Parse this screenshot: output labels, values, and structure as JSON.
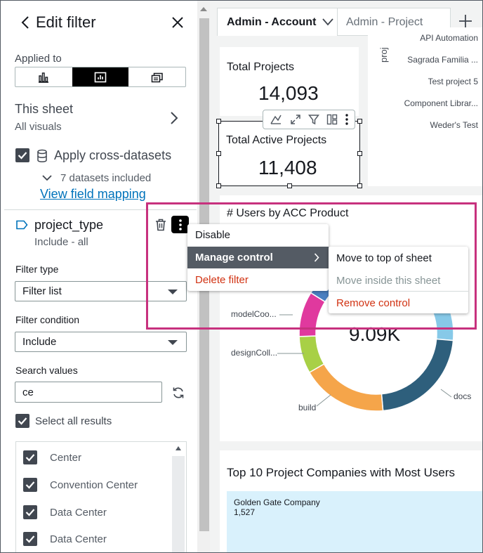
{
  "panel": {
    "title": "Edit filter",
    "applied_to_label": "Applied to",
    "applied_to_options": [
      "bar-chart-icon",
      "visual-icon",
      "multi-sheet-icon"
    ],
    "applied_to_selected": 1,
    "sheet_title": "This sheet",
    "sheet_subtitle": "All visuals",
    "cross_datasets_label": "Apply cross-datasets",
    "cross_datasets_checked": true,
    "datasets_included": "7 datasets included",
    "field_mapping_link": "View field mapping",
    "filter_name": "project_type",
    "filter_summary": "Include - all",
    "filter_type_label": "Filter type",
    "filter_type_value": "Filter list",
    "filter_condition_label": "Filter condition",
    "filter_condition_value": "Include",
    "search_values_label": "Search values",
    "search_value": "ce",
    "select_all_label": "Select all results",
    "select_all_checked": true,
    "results": [
      {
        "label": "Center",
        "checked": true
      },
      {
        "label": "Convention Center",
        "checked": true
      },
      {
        "label": "Data Center",
        "checked": true
      },
      {
        "label": "Data Center",
        "checked": true
      }
    ]
  },
  "tabs": {
    "active": "Admin - Account",
    "inactive": "Admin - Project"
  },
  "dashboard": {
    "total_projects_title": "Total Projects",
    "total_projects_value": "14,093",
    "active_projects_title": "Total Active Projects",
    "active_projects_value": "11,408",
    "bar_chart_axis_title": "proj",
    "bar_chart_labels": [
      "API Automation",
      "Sagrada Familia ...",
      "Test project 5",
      "Component Librar...",
      "Weder's Test"
    ],
    "donut_title": "# Users by ACC Product",
    "donut_center": "9.09K",
    "donut_labels": {
      "model": "modelCoo...",
      "design": "designColl...",
      "build": "build",
      "docs": "docs"
    },
    "top10_title": "Top 10 Project Companies with Most Users",
    "top10_first_name": "Golden Gate Company",
    "top10_first_value": "1,527"
  },
  "context_menu": {
    "items": [
      "Disable",
      "Manage control",
      "Delete filter"
    ],
    "active_index": 1
  },
  "submenu": {
    "items": [
      "Move to top of sheet",
      "Move inside this sheet",
      "Remove control"
    ],
    "disabled_index": 1
  },
  "chart_data": {
    "type": "pie",
    "title": "# Users by ACC Product",
    "center_label": "9.09K",
    "categories": [
      "docs",
      "build",
      "designColl...",
      "modelCoo..."
    ],
    "values": [
      30,
      19,
      8,
      9
    ],
    "colors": {
      "docs": "#2e5f7c",
      "build": "#f5a54a",
      "design": "#a8d046",
      "model": "#e0399e",
      "other_blue": "#4a7fc0",
      "light_blue": "#87c9e8"
    }
  }
}
